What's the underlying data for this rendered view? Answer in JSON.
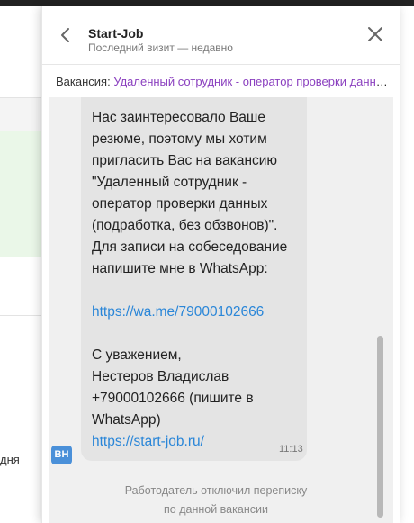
{
  "header": {
    "title": "Start-Job",
    "subtitle": "Последний визит — недавно"
  },
  "vacancy": {
    "label": "Вакансия:",
    "link": "Удаленный сотрудник - оператор проверки данных (подработка, без обзвонов)"
  },
  "message": {
    "text_1": "Нас заинтересовало Ваше резюме, поэтому мы хотим пригласить Вас на вакансию \"Удаленный сотрудник - оператор проверки данных (подработка, без обзвонов)\". Для записи на собеседование напишите мне в WhatsApp:",
    "link_1": "https://wa.me/79000102666",
    "text_2": "С уважением,\nНестеров Владислав\n+79000102666 (пишите в WhatsApp)",
    "link_2": "https://start-job.ru/",
    "time": "11:13"
  },
  "avatar": {
    "initials": "ВН"
  },
  "notice": "Работодатель отключил переписку\nпо данной вакансии",
  "background": {
    "partial_text": "дня"
  },
  "colors": {
    "link": "#2a86d8",
    "vacancy_link": "#8a3fbf",
    "avatar": "#4a90d9"
  }
}
